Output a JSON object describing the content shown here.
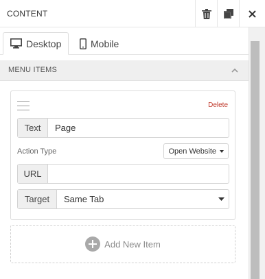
{
  "header": {
    "title": "CONTENT",
    "actions": [
      {
        "name": "trash-icon",
        "label": "Delete"
      },
      {
        "name": "copy-icon",
        "label": "Duplicate"
      },
      {
        "name": "close-icon",
        "label": "Close"
      }
    ]
  },
  "tabs": [
    {
      "label": "Desktop",
      "icon": "desktop-icon",
      "active": true
    },
    {
      "label": "Mobile",
      "icon": "mobile-icon",
      "active": false
    }
  ],
  "section": {
    "title": "MENU ITEMS",
    "toggle_icon": "chevron-up-icon"
  },
  "menu_item": {
    "delete_label": "Delete",
    "text_label": "Text",
    "text_value": "Page",
    "action_type_label": "Action Type",
    "action_type_value": "Open Website",
    "url_label": "URL",
    "url_value": "",
    "target_label": "Target",
    "target_value": "Same Tab"
  },
  "add_item": {
    "label": "Add New Item",
    "icon": "plus-circle-icon"
  },
  "colors": {
    "delete": "#c0392b",
    "section_bg": "#efefef",
    "scroll_thumb": "#bdbdbd"
  }
}
